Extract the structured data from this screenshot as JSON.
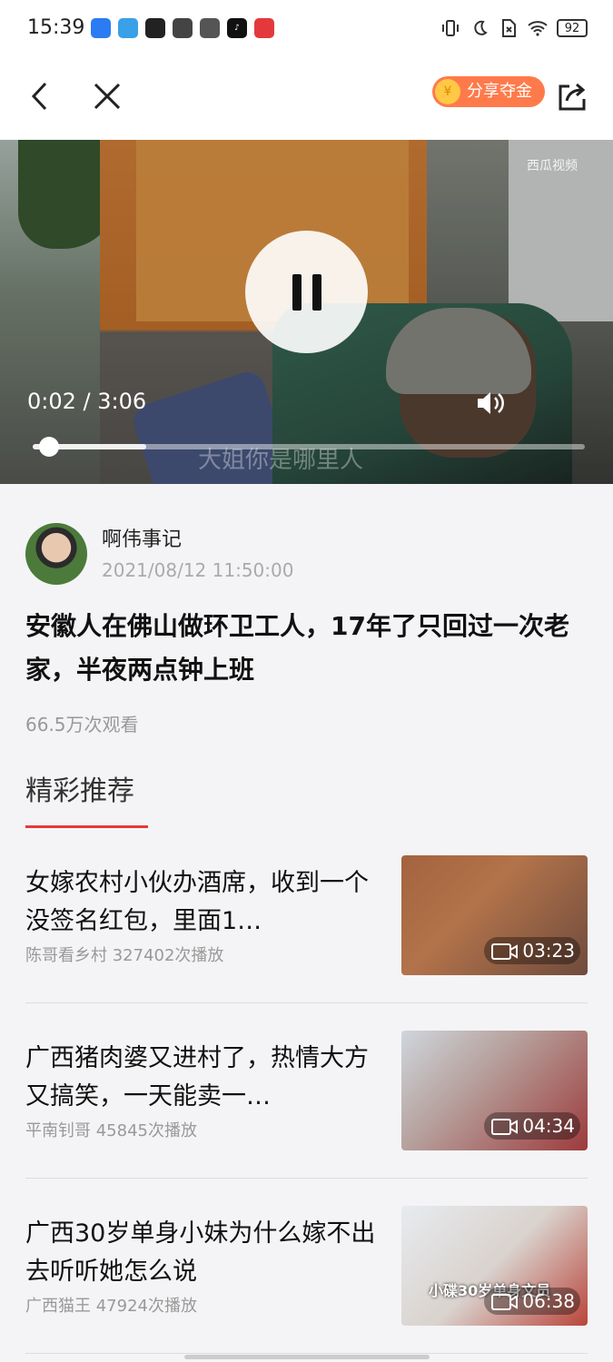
{
  "status_bar": {
    "time": "15:39",
    "battery": "92",
    "apps": [
      {
        "name": "app-blue-icon",
        "color": "#2b7cf2",
        "label": ""
      },
      {
        "name": "app-calendar-icon",
        "color": "#3aa0e8",
        "label": ""
      },
      {
        "name": "app-news-icon",
        "color": "#222222",
        "label": ""
      },
      {
        "name": "app-youku-icon",
        "color": "#444444",
        "label": ""
      },
      {
        "name": "app-mail-icon",
        "color": "#555555",
        "label": ""
      },
      {
        "name": "app-tiktok-icon",
        "color": "#111111",
        "label": ""
      },
      {
        "name": "app-red-icon",
        "color": "#e4393c",
        "label": ""
      }
    ]
  },
  "nav": {
    "share_gold_label": "分享夺金",
    "coin_glyph": "¥"
  },
  "video": {
    "watermark": "西瓜视频",
    "time": "0:02 / 3:06",
    "subtitle": "大姐你是哪里人",
    "progress": 0.011
  },
  "author": {
    "name": "啊伟事记",
    "date": "2021/08/12 11:50:00"
  },
  "article": {
    "title": "安徽人在佛山做环卫工人，17年了只回过一次老家，半夜两点钟上班",
    "views": "66.5万次观看"
  },
  "section": {
    "title": "精彩推荐"
  },
  "recommendations": [
    {
      "title": "女嫁农村小伙办酒席，收到一个没签名红包，里面1…",
      "meta": "陈哥看乡村  327402次播放",
      "duration": "03:23"
    },
    {
      "title": "广西猪肉婆又进村了，热情大方又搞笑，一天能卖一…",
      "meta": "平南钊哥  45845次播放",
      "duration": "04:34"
    },
    {
      "title": "广西30岁单身小妹为什么嫁不出去听听她怎么说",
      "meta": "广西猫王  47924次播放",
      "duration": "06:38",
      "thumb_text": "小碟30岁单身文员"
    }
  ],
  "colors": {
    "accent": "#e4393c",
    "share_gold": "#ff7a4a"
  }
}
